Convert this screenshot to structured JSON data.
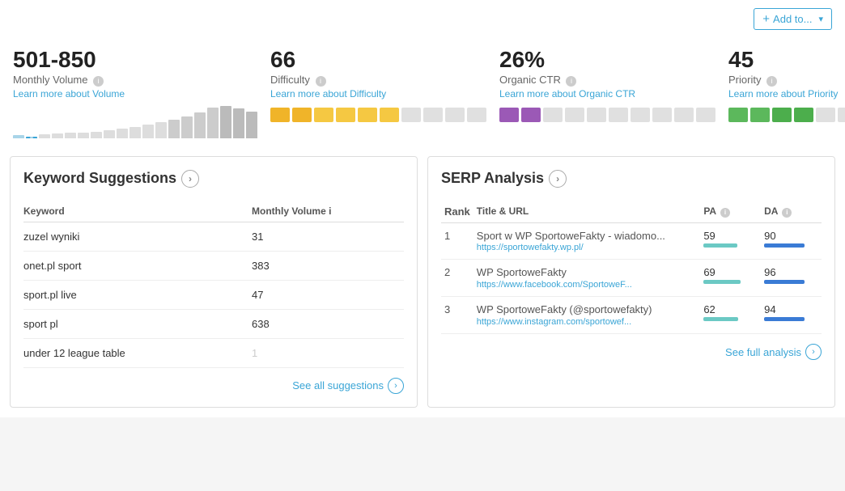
{
  "topBar": {
    "addToLabel": "Add to...",
    "plusSymbol": "+"
  },
  "metrics": [
    {
      "id": "monthly-volume",
      "value": "501-850",
      "label": "Monthly Volume",
      "link": "Learn more about Volume",
      "chartType": "bar",
      "bars": [
        2,
        3,
        3,
        4,
        5,
        4,
        6,
        7,
        8,
        9,
        11,
        13,
        15,
        18,
        22,
        26,
        30,
        28,
        24
      ]
    },
    {
      "id": "difficulty",
      "value": "66",
      "label": "Difficulty",
      "link": "Learn more about Difficulty",
      "chartType": "segment",
      "segments": [
        "filled",
        "filled",
        "filled",
        "filled",
        "filled",
        "filled",
        "empty",
        "empty",
        "empty",
        "empty"
      ],
      "color": "#f0b429"
    },
    {
      "id": "organic-ctr",
      "value": "26%",
      "label": "Organic CTR",
      "link": "Learn more about Organic CTR",
      "chartType": "segment",
      "segments": [
        "filled",
        "filled",
        "empty",
        "empty",
        "empty",
        "empty",
        "empty",
        "empty",
        "empty",
        "empty"
      ],
      "color": "#9b59b6"
    },
    {
      "id": "priority",
      "value": "45",
      "label": "Priority",
      "link": "Learn more about Priority",
      "chartType": "segment",
      "segments": [
        "filled",
        "filled",
        "filled",
        "filled",
        "empty",
        "empty",
        "empty",
        "empty",
        "empty",
        "empty"
      ],
      "color": "#5cb85c"
    }
  ],
  "keywordSuggestions": {
    "title": "Keyword Suggestions",
    "colKeyword": "Keyword",
    "colVolume": "Monthly Volume",
    "infoIcon": "i",
    "rows": [
      {
        "keyword": "zuzel wyniki",
        "volume": "31",
        "low": false
      },
      {
        "keyword": "onet.pl sport",
        "volume": "383",
        "low": false
      },
      {
        "keyword": "sport.pl live",
        "volume": "47",
        "low": false
      },
      {
        "keyword": "sport pl",
        "volume": "638",
        "low": false
      },
      {
        "keyword": "under 12 league table",
        "volume": "1",
        "low": true
      }
    ],
    "seeAllLabel": "See all suggestions"
  },
  "serpAnalysis": {
    "title": "SERP Analysis",
    "colRank": "Rank",
    "colTitle": "Title & URL",
    "colPA": "PA",
    "colDA": "DA",
    "rows": [
      {
        "rank": "1",
        "title": "Sport w WP SportoweFakty - wiadomo...",
        "url": "https://sportowefakty.wp.pl/",
        "pa": 59,
        "paWidth": 42,
        "da": 90,
        "daWidth": 50
      },
      {
        "rank": "2",
        "title": "WP SportoweFakty",
        "url": "https://www.facebook.com/SportoweF...",
        "pa": 69,
        "paWidth": 46,
        "da": 96,
        "daWidth": 50
      },
      {
        "rank": "3",
        "title": "WP SportoweFakty (@sportowefakty)",
        "url": "https://www.instagram.com/sportowef...",
        "pa": 62,
        "paWidth": 43,
        "da": 94,
        "daWidth": 50
      }
    ],
    "seeFullLabel": "See full analysis"
  }
}
